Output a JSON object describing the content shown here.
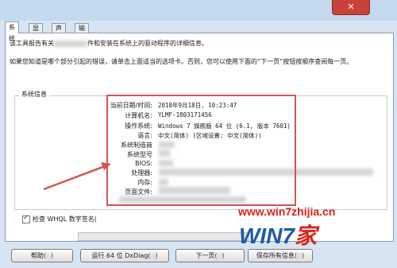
{
  "window": {
    "close_glyph": "✕"
  },
  "tabs": [
    {
      "label": "系统"
    },
    {
      "label": "显示"
    },
    {
      "label": "声音"
    },
    {
      "label": "输入"
    }
  ],
  "intro": {
    "line1_start": "该工具报告有关",
    "line1_end": "件和安装在系统上的驱动程序的详细信息。",
    "line2": "如果您知道是哪个部分引起的错误，请单击上面适当的选项卡。否则，您可以使用下面的“下一页”按钮按顺序查阅每一页。"
  },
  "system_info": {
    "group_label": "系统信息",
    "rows": [
      {
        "label": "当前日期/时间:",
        "value": "2018年9月18日, 10:23:47"
      },
      {
        "label": "计算机名:",
        "value": "YLMF-1803171456"
      },
      {
        "label": "操作系统:",
        "value": "Windows 7 旗舰版 64 位 (6.1, 版本 7601)"
      },
      {
        "label": "语言:",
        "value": "中文(简体) (区域设置: 中文(简体))"
      },
      {
        "label": "系统制造商",
        "value": ""
      },
      {
        "label": "系统型号",
        "value": ""
      },
      {
        "label": "BIOS:",
        "value": ""
      },
      {
        "label": "处理器:",
        "value": ""
      },
      {
        "label": "内存:",
        "value": ""
      },
      {
        "label": "页面文件:",
        "value": ""
      }
    ]
  },
  "check_whql": {
    "label": "检查 WHQL 数字签名(",
    "checked": true
  },
  "buttons": {
    "help": "帮助(",
    "run_dxdiag": "运行 64 位 DxDiag(",
    "next_page": "下一页(",
    "save_all": "保存所有信息("
  },
  "watermark": {
    "url": "www.win7zhijia.cn",
    "logo_text": "WIN7",
    "logo_suffix": "家"
  },
  "colors": {
    "annotation_red": "#d9534f",
    "watermark_red": "#e0201a",
    "logo_blue": "#1f5aa6"
  }
}
